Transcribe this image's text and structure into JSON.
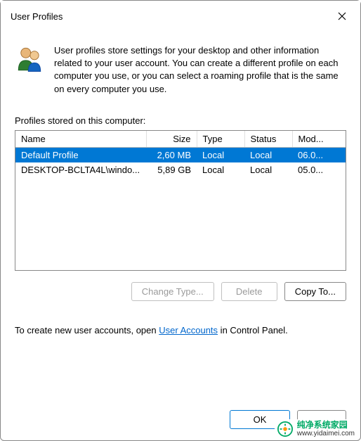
{
  "dialog": {
    "title": "User Profiles"
  },
  "intro": {
    "text": "User profiles store settings for your desktop and other information related to your user account. You can create a different profile on each computer you use, or you can select a roaming profile that is the same on every computer you use."
  },
  "profiles": {
    "label": "Profiles stored on this computer:",
    "columns": {
      "name": "Name",
      "size": "Size",
      "type": "Type",
      "status": "Status",
      "modified": "Mod..."
    },
    "rows": [
      {
        "name": "Default Profile",
        "size": "2,60 MB",
        "type": "Local",
        "status": "Local",
        "modified": "06.0..."
      },
      {
        "name": "DESKTOP-BCLTA4L\\windo...",
        "size": "5,89 GB",
        "type": "Local",
        "status": "Local",
        "modified": "05.0..."
      }
    ]
  },
  "buttons": {
    "change_type": "Change Type...",
    "delete": "Delete",
    "copy_to": "Copy To...",
    "ok": "OK",
    "cancel": ""
  },
  "footer_help": {
    "prefix": "To create new user accounts, open ",
    "link": "User Accounts",
    "suffix": " in Control Panel."
  },
  "watermark": {
    "text_cn": "纯净系统家园",
    "text_url": "www.yidaimei.com"
  }
}
